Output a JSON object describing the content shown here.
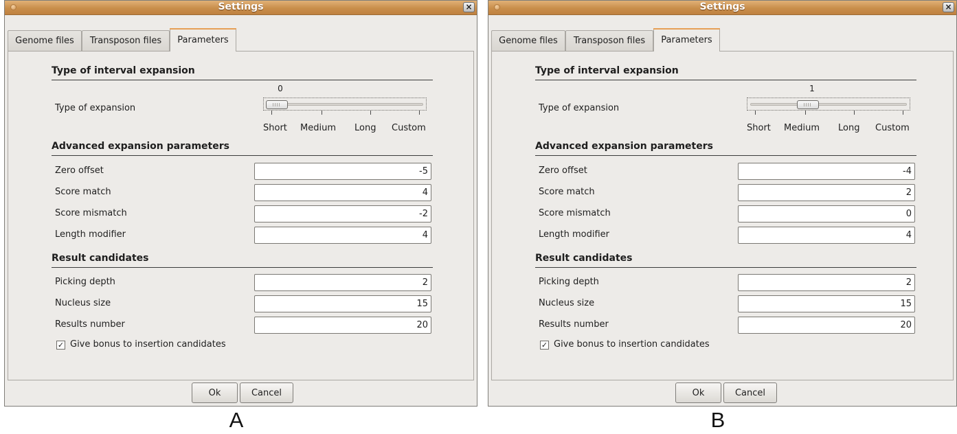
{
  "dialogs": [
    {
      "title": "Settings",
      "close_glyph": "×",
      "tabs": [
        "Genome files",
        "Transposon files",
        "Parameters"
      ],
      "active_tab": "Parameters",
      "section_interval": "Type of interval expansion",
      "expansion_label": "Type of expansion",
      "slider_value": "0",
      "slider_labels": [
        "Short",
        "Medium",
        "Long",
        "Custom"
      ],
      "section_advanced": "Advanced expansion parameters",
      "advanced_fields": [
        {
          "label": "Zero offset",
          "value": "-5"
        },
        {
          "label": "Score match",
          "value": "4"
        },
        {
          "label": "Score mismatch",
          "value": "-2"
        },
        {
          "label": "Length modifier",
          "value": "4"
        }
      ],
      "section_results": "Result candidates",
      "result_fields": [
        {
          "label": "Picking depth",
          "value": "2"
        },
        {
          "label": "Nucleus size",
          "value": "15"
        },
        {
          "label": "Results number",
          "value": "20"
        }
      ],
      "bonus_checkbox": {
        "label": "Give bonus to insertion candidates",
        "checked": true,
        "glyph": "✓"
      },
      "ok_label": "Ok",
      "cancel_label": "Cancel",
      "caption": "A"
    },
    {
      "title": "Settings",
      "close_glyph": "×",
      "tabs": [
        "Genome files",
        "Transposon files",
        "Parameters"
      ],
      "active_tab": "Parameters",
      "section_interval": "Type of interval expansion",
      "expansion_label": "Type of expansion",
      "slider_value": "1",
      "slider_labels": [
        "Short",
        "Medium",
        "Long",
        "Custom"
      ],
      "section_advanced": "Advanced expansion parameters",
      "advanced_fields": [
        {
          "label": "Zero offset",
          "value": "-4"
        },
        {
          "label": "Score match",
          "value": "2"
        },
        {
          "label": "Score mismatch",
          "value": "0"
        },
        {
          "label": "Length modifier",
          "value": "4"
        }
      ],
      "section_results": "Result candidates",
      "result_fields": [
        {
          "label": "Picking depth",
          "value": "2"
        },
        {
          "label": "Nucleus size",
          "value": "15"
        },
        {
          "label": "Results number",
          "value": "20"
        }
      ],
      "bonus_checkbox": {
        "label": "Give bonus to insertion candidates",
        "checked": true,
        "glyph": "✓"
      },
      "ok_label": "Ok",
      "cancel_label": "Cancel",
      "caption": "B"
    }
  ],
  "colors": {
    "titlebar": "#c98e4b",
    "active_tab_accent": "#e69f55",
    "window_background": "#edebe8"
  }
}
